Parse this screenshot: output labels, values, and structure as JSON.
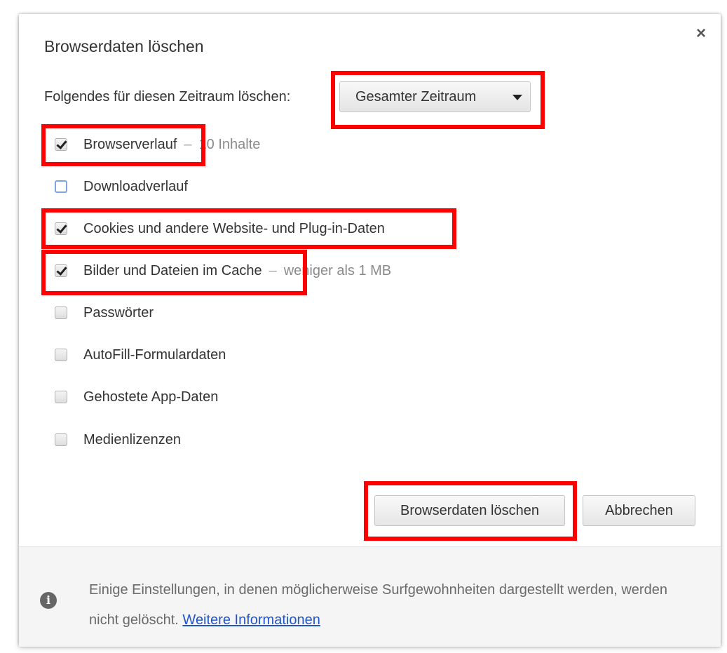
{
  "dialog": {
    "title": "Browserdaten löschen",
    "close_symbol": "×",
    "time_range": {
      "label": "Folgendes für diesen Zeitraum löschen:",
      "selected": "Gesamter Zeitraum"
    },
    "options": [
      {
        "label": "Browserverlauf",
        "checked": true,
        "detail": "10 Inhalte"
      },
      {
        "label": "Downloadverlauf",
        "checked": false,
        "detail": ""
      },
      {
        "label": "Cookies und andere Website- und Plug-in-Daten",
        "checked": true,
        "detail": ""
      },
      {
        "label": "Bilder und Dateien im Cache",
        "checked": true,
        "detail": "weniger als 1 MB"
      },
      {
        "label": "Passwörter",
        "checked": false,
        "detail": ""
      },
      {
        "label": "AutoFill-Formulardaten",
        "checked": false,
        "detail": ""
      },
      {
        "label": "Gehostete App-Daten",
        "checked": false,
        "detail": ""
      },
      {
        "label": "Medienlizenzen",
        "checked": false,
        "detail": ""
      }
    ],
    "buttons": {
      "clear": "Browserdaten löschen",
      "cancel": "Abbrechen"
    },
    "footer": {
      "text": "Einige Einstellungen, in denen möglicherweise Surfgewohnheiten dargestellt werden, werden nicht gelöscht.",
      "link": "Weitere Informationen"
    }
  },
  "annotation_color": "#ff0000"
}
